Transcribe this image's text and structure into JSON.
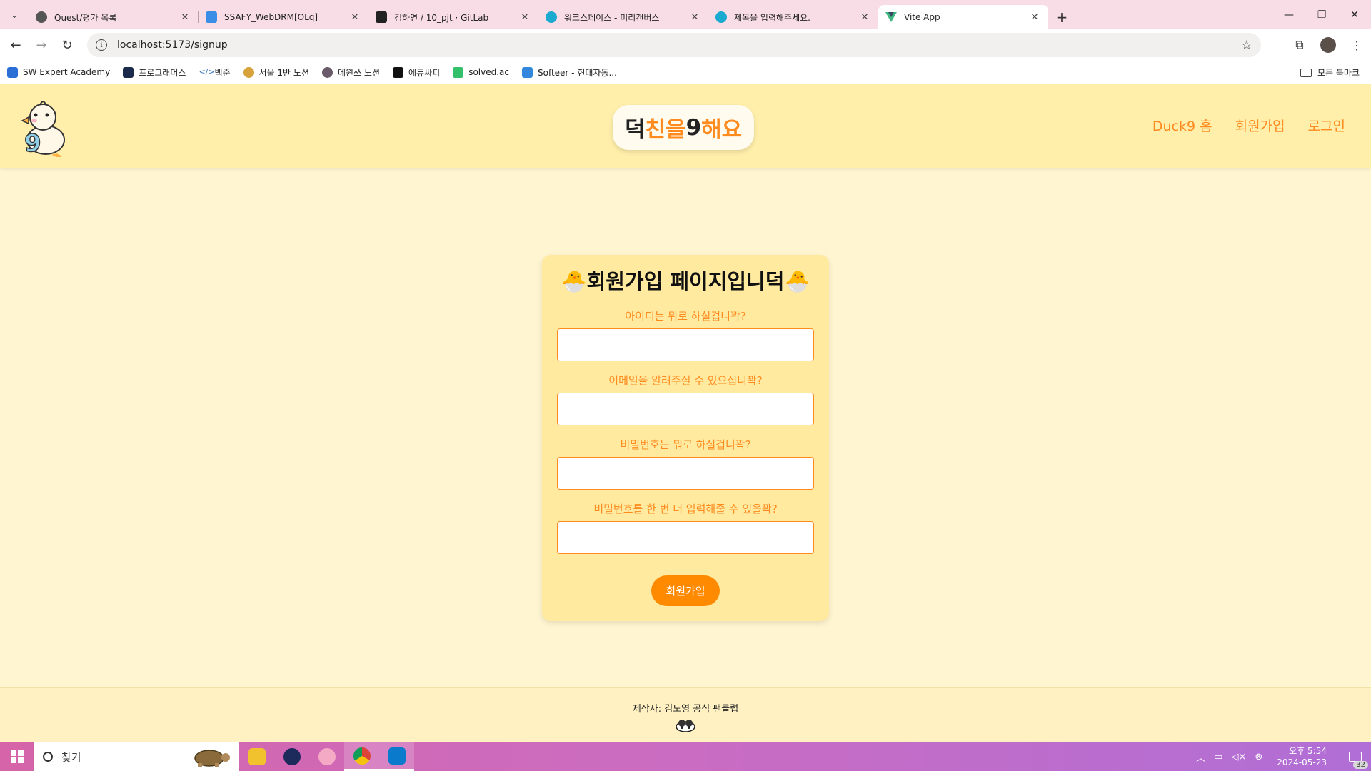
{
  "browser": {
    "tabs": [
      {
        "title": "Quest/평가 목록",
        "color": "#555555"
      },
      {
        "title": "SSAFY_WebDRM[OLq]",
        "color": "#3a8ee6"
      },
      {
        "title": "김하연 / 10_pjt · GitLab",
        "color": "#222222"
      },
      {
        "title": "워크스페이스 - 미리캔버스",
        "color": "#1aaad0"
      },
      {
        "title": "제목을 입력해주세요.",
        "color": "#1aaad0"
      },
      {
        "title": "Vite App",
        "color": "#41b883"
      }
    ],
    "address": "localhost:5173/signup",
    "bookmarks": [
      {
        "label": "SW Expert Academy",
        "color": "#2b6fd6"
      },
      {
        "label": "프로그래머스",
        "color": "#1b2a4a"
      },
      {
        "label": "백준",
        "color": "#3a76c4"
      },
      {
        "label": "서울 1반 노션",
        "color": "#d8a23a"
      },
      {
        "label": "메윈쓰 노션",
        "color": "#6a5a6a"
      },
      {
        "label": "에듀싸피",
        "color": "#111111"
      },
      {
        "label": "solved.ac",
        "color": "#33c06a"
      },
      {
        "label": "Softeer - 현대자동...",
        "color": "#3388dd"
      }
    ],
    "all_bookmarks": "모든 북마크"
  },
  "header": {
    "brand": {
      "p1": "덕",
      "p2": "친을 ",
      "p3": "9",
      "p4": "해요"
    },
    "nav": [
      "Duck9 홈",
      "회원가입",
      "로그인"
    ]
  },
  "signup": {
    "title": "🐣회원가입 페이지입니덕🐣",
    "fields": [
      {
        "label": "아이디는 뭐로 하실겁니꽉?",
        "value": ""
      },
      {
        "label": "이메일을 알려주실 수 있으십니꽉?",
        "value": ""
      },
      {
        "label": "비밀번호는 뭐로 하실겁니꽉?",
        "value": ""
      },
      {
        "label": "비밀번호를 한 번 더 입력해줄 수 있을꽉?",
        "value": ""
      }
    ],
    "submit": "회원가입"
  },
  "footer": {
    "text": "제작사: 김도영 공식 팬클럽"
  },
  "taskbar": {
    "search_placeholder": "찾기",
    "time": "오후 5:54",
    "date": "2024-05-23",
    "notification_count": "32"
  }
}
